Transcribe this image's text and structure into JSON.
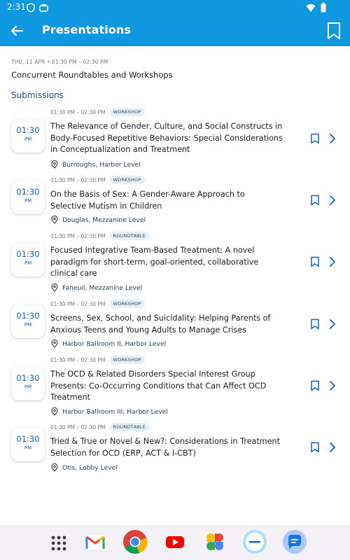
{
  "status_bar": {
    "time": "2:31",
    "icons": [
      "shield-icon",
      "briefcase-icon",
      "wifi-icon",
      "battery-icon"
    ]
  },
  "app_bar": {
    "title": "Presentations",
    "back_icon": "arrow-left-icon",
    "bookmark_icon": "bookmark-icon"
  },
  "session": {
    "date": "THU, 11 APR • 01:30 PM – 02:30 PM",
    "title": "Concurrent Roundtables and Workshops"
  },
  "section_label": "Submissions",
  "items": [
    {
      "time_range": "01:30 PM – 02:30 PM",
      "type": "WORKSHOP",
      "time": "01:30",
      "ampm": "PM",
      "title": "The Relevance of Gender, Culture, and Social Constructs in Body-Focused Repetitive Behaviors: Special Considerations in Conceptualization and Treatment",
      "location": "Burroughs, Harbor Level"
    },
    {
      "time_range": "01:30 PM – 02:30 PM",
      "type": "WORKSHOP",
      "time": "01:30",
      "ampm": "PM",
      "title": "On the Basis of Sex: A Gender-Aware Approach to Selective Mutism in Children",
      "location": "Douglas, Mezzanine Level"
    },
    {
      "time_range": "01:30 PM – 02:30 PM",
      "type": "ROUNDTABLE",
      "time": "01:30",
      "ampm": "PM",
      "title": "Focused Integrative Team-Based Treatment: A novel paradigm for short-term, goal-oriented, collaborative clinical care",
      "location": "Faneuil, Mezzanine Level"
    },
    {
      "time_range": "01:30 PM – 02:30 PM",
      "type": "WORKSHOP",
      "time": "01:30",
      "ampm": "PM",
      "title": "Screens, Sex, School, and Suicidality: Helping Parents of Anxious Teens and Young Adults to Manage Crises",
      "location": "Harbor Ballroom II, Harbor Level"
    },
    {
      "time_range": "01:30 PM – 02:30 PM",
      "type": "WORKSHOP",
      "time": "01:30",
      "ampm": "PM",
      "title": "The OCD & Related Disorders Special Interest Group Presents: Co-Occurring Conditions that Can Affect OCD Treatment",
      "location": "Harbor Ballroom III, Harbor Level"
    },
    {
      "time_range": "01:30 PM – 02:30 PM",
      "type": "ROUNDTABLE",
      "time": "01:30",
      "ampm": "PM",
      "title": "Tried & True or Novel & New?: Considerations in Treatment Selection for OCD (ERP, ACT & I-CBT)",
      "location": "Otis, Lobby Level"
    }
  ],
  "dock": {
    "apps": [
      "app-drawer-icon",
      "gmail-icon",
      "chrome-icon",
      "youtube-icon",
      "photos-icon",
      "app-icon",
      "messages-icon"
    ]
  },
  "colors": {
    "primary": "#0f97e0",
    "accent_text": "#1560b8",
    "badge_bg": "#e6eef6"
  }
}
